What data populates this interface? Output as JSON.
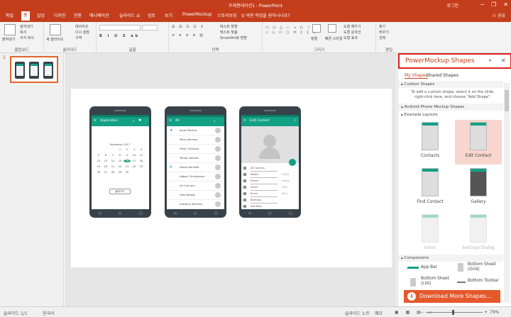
{
  "titlebar": {
    "document": "프레젠테이션1 - PowerPoint",
    "login": "로그인",
    "min": "─",
    "restore": "❐",
    "close": "✕"
  },
  "tabs": [
    {
      "label": "파일"
    },
    {
      "label": "홈"
    },
    {
      "label": "삽입"
    },
    {
      "label": "디자인"
    },
    {
      "label": "전환"
    },
    {
      "label": "애니메이션"
    },
    {
      "label": "슬라이드 쇼"
    },
    {
      "label": "검토"
    },
    {
      "label": "보기"
    },
    {
      "label": "PowerMockup"
    },
    {
      "label": "스토리보딩"
    }
  ],
  "tell_me": "어떤 작업을 원하시나요?",
  "share": "공유",
  "ribbon": {
    "paste": "붙여넣기",
    "cut": "잘라내기",
    "copy": "복사",
    "format_painter": "서식 복사",
    "new_slide": "새 슬라이드",
    "layout": "레이아웃",
    "reset": "다시 설정",
    "section": "구역",
    "text_direction": "텍스트 방향",
    "align_text": "텍스트 맞춤",
    "smartart": "SmartArt로 변환",
    "arrange": "정렬",
    "quick_styles": "빠른 스타일",
    "shape_fill": "도형 채우기",
    "shape_outline": "도형 윤곽선",
    "shape_effects": "도형 효과",
    "find": "찾기",
    "replace": "바꾸기",
    "select": "선택",
    "groups": {
      "clipboard": "클립보드",
      "slides": "슬라이드",
      "font": "글꼴",
      "paragraph": "단락",
      "drawing": "그리기",
      "editing": "편집"
    }
  },
  "thumbnail": {
    "number": "1"
  },
  "phone1": {
    "title": "Application",
    "month": "November 2017",
    "days": [
      "",
      "",
      "",
      "1",
      "2",
      "3",
      "4",
      "5",
      "6",
      "7",
      "8",
      "9",
      "10",
      "11",
      "12",
      "13",
      "14",
      "15",
      "16",
      "17",
      "18",
      "19",
      "20",
      "21",
      "22",
      "23",
      "24",
      "25",
      "26",
      "27",
      "28",
      "29",
      "30",
      "",
      ""
    ],
    "selected_day": "16",
    "button": "돌아가기"
  },
  "phone2": {
    "title": "All",
    "contacts": [
      {
        "initial": "★",
        "name": "Janet Perkins"
      },
      {
        "initial": "",
        "name": "Mary Johnson"
      },
      {
        "initial": "",
        "name": "Peter Carlsson"
      },
      {
        "initial": "",
        "name": "Trevor Hansen"
      },
      {
        "initial": "A",
        "name": "Aaron Bennett"
      },
      {
        "initial": "",
        "name": "Abbey Christensen"
      },
      {
        "initial": "",
        "name": "Ali Connors"
      },
      {
        "initial": "",
        "name": "Alex Nelson"
      },
      {
        "initial": "",
        "name": "Anthony Stevens"
      }
    ]
  },
  "phone3": {
    "title": "Edit Contact",
    "fields": [
      {
        "text": "Ali Connors",
        "detail": ""
      },
      {
        "text": "Mobile",
        "detail": "Mobile"
      },
      {
        "text": "Phone",
        "detail": "Mobile"
      },
      {
        "text": "Email",
        "detail": "Work"
      },
      {
        "text": "Email",
        "detail": "Work"
      },
      {
        "text": "Birthday",
        "detail": ""
      },
      {
        "text": "Add field",
        "detail": ""
      }
    ]
  },
  "panel": {
    "title": "PowerMockup Shapes",
    "tab_my": "My Shapes",
    "tab_shared": "Shared Shapes",
    "custom_header": "Custom Shapes",
    "custom_note": "To add a custom shape, select it on the slide, right-click here, and choose \"Add Shape\".",
    "library_header": "Android Phone Mockup Shapes",
    "example_header": "Example Layouts",
    "layouts": [
      {
        "label": "Contacts"
      },
      {
        "label": "Edit Contact"
      },
      {
        "label": "Find Contact"
      },
      {
        "label": "Gallery"
      },
      {
        "label": "Inbox"
      },
      {
        "label": "Settings Dialog"
      }
    ],
    "components_header": "Components",
    "components": [
      {
        "label": "App Bar"
      },
      {
        "label": "Bottom Sheet (Grid)"
      },
      {
        "label": "Bottom Sheet (List)"
      },
      {
        "label": "Bottom Toolbar"
      }
    ],
    "download": "Download More Shapes..."
  },
  "status": {
    "slide": "슬라이드 1/1",
    "language": "한국어",
    "notes": "슬라이드 노트",
    "comments": "메모",
    "zoom": "79%"
  },
  "colors": {
    "accent": "#c43e1c",
    "android_teal": "#13a185",
    "phone_body": "#37424a"
  }
}
